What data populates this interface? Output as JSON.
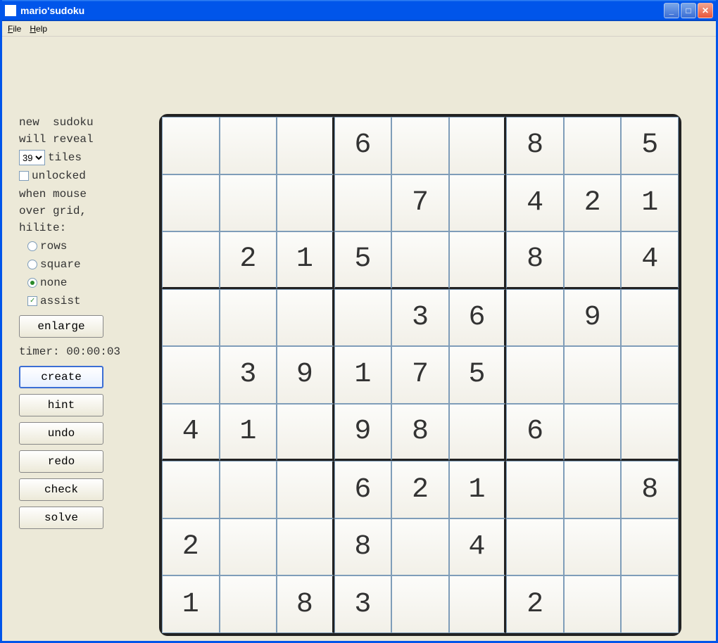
{
  "window": {
    "title": "mario'sudoku"
  },
  "menu": {
    "file": "File",
    "help": "Help"
  },
  "sidebar": {
    "line1": "new  sudoku",
    "line2": "will reveal",
    "tiles_value": "39",
    "tiles_label": "tiles",
    "unlocked_label": "unlocked",
    "unlocked_checked": false,
    "hilite_line1": "when mouse",
    "hilite_line2": "over grid,",
    "hilite_line3": "hilite:",
    "radio_rows": "rows",
    "radio_square": "square",
    "radio_none": "none",
    "radio_selected": "none",
    "assist_label": "assist",
    "assist_checked": true,
    "enlarge": "enlarge",
    "timer_label": "timer: ",
    "timer_value": "00:00:03",
    "create": "create",
    "hint": "hint",
    "undo": "undo",
    "redo": "redo",
    "check": "check",
    "solve": "solve"
  },
  "grid": [
    [
      "",
      "",
      "",
      "6",
      "",
      "",
      "8",
      "",
      "5"
    ],
    [
      "",
      "",
      "",
      "",
      "7",
      "",
      "4",
      "2",
      "1"
    ],
    [
      "",
      "2",
      "1",
      "5",
      "",
      "",
      "8",
      "",
      "4"
    ],
    [
      "",
      "",
      "",
      "",
      "3",
      "6",
      "",
      "9",
      ""
    ],
    [
      "",
      "3",
      "9",
      "1",
      "7",
      "5",
      "",
      "",
      ""
    ],
    [
      "4",
      "1",
      "",
      "9",
      "8",
      "",
      "6",
      "",
      ""
    ],
    [
      "",
      "",
      "",
      "6",
      "2",
      "1",
      "",
      "",
      "8"
    ],
    [
      "2",
      "",
      "",
      "8",
      "",
      "4",
      "",
      "",
      ""
    ],
    [
      "1",
      "",
      "8",
      "3",
      "",
      "",
      "2",
      "",
      ""
    ]
  ]
}
